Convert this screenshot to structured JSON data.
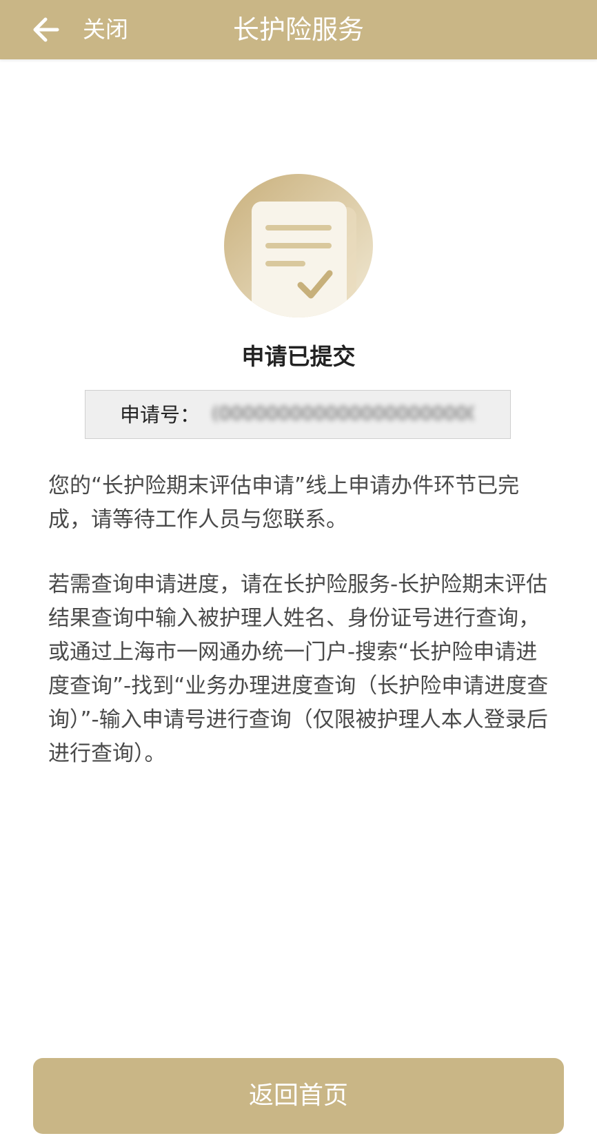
{
  "header": {
    "back_icon": "arrow-left-icon",
    "close_label": "关闭",
    "title": "长护险服务"
  },
  "status": {
    "icon": "document-check-icon",
    "title": "申请已提交"
  },
  "application": {
    "label": "申请号：",
    "value": "(0000000000000000000000"
  },
  "content": {
    "paragraph1": "您的“长护险期末评估申请”线上申请办件环节已完成，请等待工作人员与您联系。",
    "paragraph2": "若需查询申请进度，请在长护险服务-长护险期末评估结果查询中输入被护理人姓名、身份证号进行查询，或通过上海市一网通办统一门户-搜索“长护险申请进度查询”-找到“业务办理进度查询（长护险申请进度查询）”-输入申请号进行查询（仅限被护理人本人登录后进行查询）。"
  },
  "footer": {
    "home_button_label": "返回首页"
  },
  "colors": {
    "brand": "#c9b686",
    "text": "#4a4a4a"
  }
}
